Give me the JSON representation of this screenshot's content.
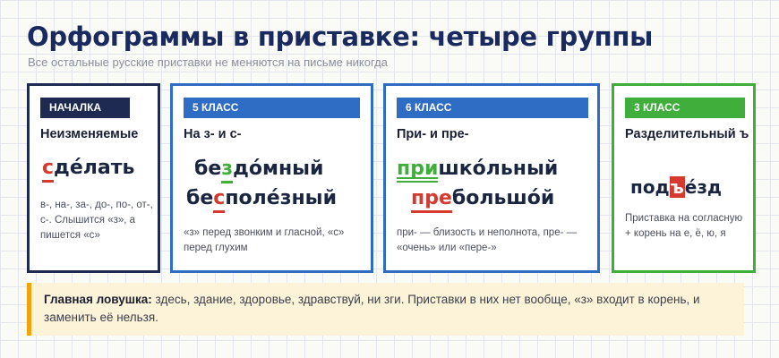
{
  "header": {
    "title": "Орфограммы в приставке: четыре группы",
    "subtitle": "Все остальные русские приставки не меняются на письме никогда"
  },
  "cards": [
    {
      "badge": "НАЧАЛКА",
      "title": "Неизменяемые",
      "word": {
        "prefix": "с",
        "rest": "де́лать"
      },
      "note": "в-, на-, за-, до-, по-, от-, с-. Слышится «з», а пишется «с»",
      "color": "#1e2a52"
    },
    {
      "badge": "5 КЛАСС",
      "title": "На з- и с-",
      "word1": {
        "start": "бе",
        "mid": "з",
        "rest": "до́мный"
      },
      "word2": {
        "start": "бе",
        "mid": "с",
        "rest": "поле́зный"
      },
      "note": "«з» перед звонким и гласной, «с» перед глухим",
      "color": "#2f6cc4"
    },
    {
      "badge": "6 КЛАСС",
      "title": "При- и пре-",
      "word1": {
        "prefix": "при",
        "rest": "шко́льный"
      },
      "word2": {
        "prefix": "пре",
        "rest": "большо́й"
      },
      "note": "при- — близость и неполнота, пре- — «очень» или «пере-»",
      "color": "#2f6cc4"
    },
    {
      "badge": "3 КЛАСС",
      "title": "Разделительный ъ",
      "word": {
        "start": "под",
        "mid": "ъ",
        "rest": "е́зд"
      },
      "note": "Приставка на согласную + корень на е, ё, ю, я",
      "color": "#3fae3a"
    }
  ],
  "trap": {
    "label": "Главная ловушка:",
    "text": " здесь, здание, здоровье, здравствуй, ни зги. Приставки в них нет вообще, «з» входит в корень, и заменить её нельзя.",
    "accent": "#f0a30a"
  }
}
